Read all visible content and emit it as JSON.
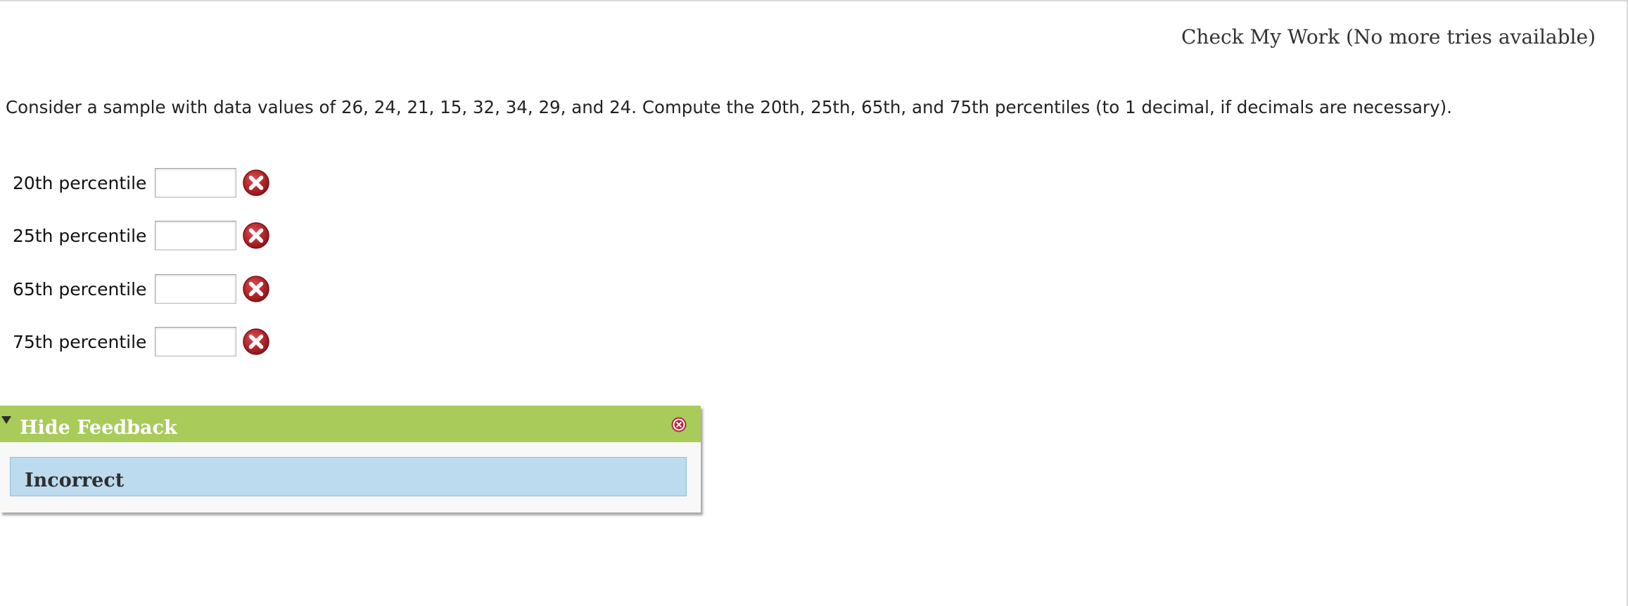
{
  "check_work": {
    "label": "Check My Work (No more tries available)"
  },
  "question": {
    "text": "Consider a sample with data values of 26, 24, 21, 15, 32, 34, 29, and 24. Compute the 20th, 25th, 65th, and 75th percentiles (to 1 decimal, if decimals are necessary)."
  },
  "answers": [
    {
      "label": "20th percentile",
      "value": "",
      "status_icon": "incorrect-icon"
    },
    {
      "label": "25th percentile",
      "value": "",
      "status_icon": "incorrect-icon"
    },
    {
      "label": "65th percentile",
      "value": "",
      "status_icon": "incorrect-icon"
    },
    {
      "label": "75th percentile",
      "value": "",
      "status_icon": "incorrect-icon"
    }
  ],
  "feedback": {
    "title": "Hide Feedback",
    "message": "Incorrect"
  },
  "colors": {
    "feedback_header": "#a8cb5a",
    "feedback_message_background": "#bcdbee",
    "incorrect_icon": "#b61e24"
  }
}
